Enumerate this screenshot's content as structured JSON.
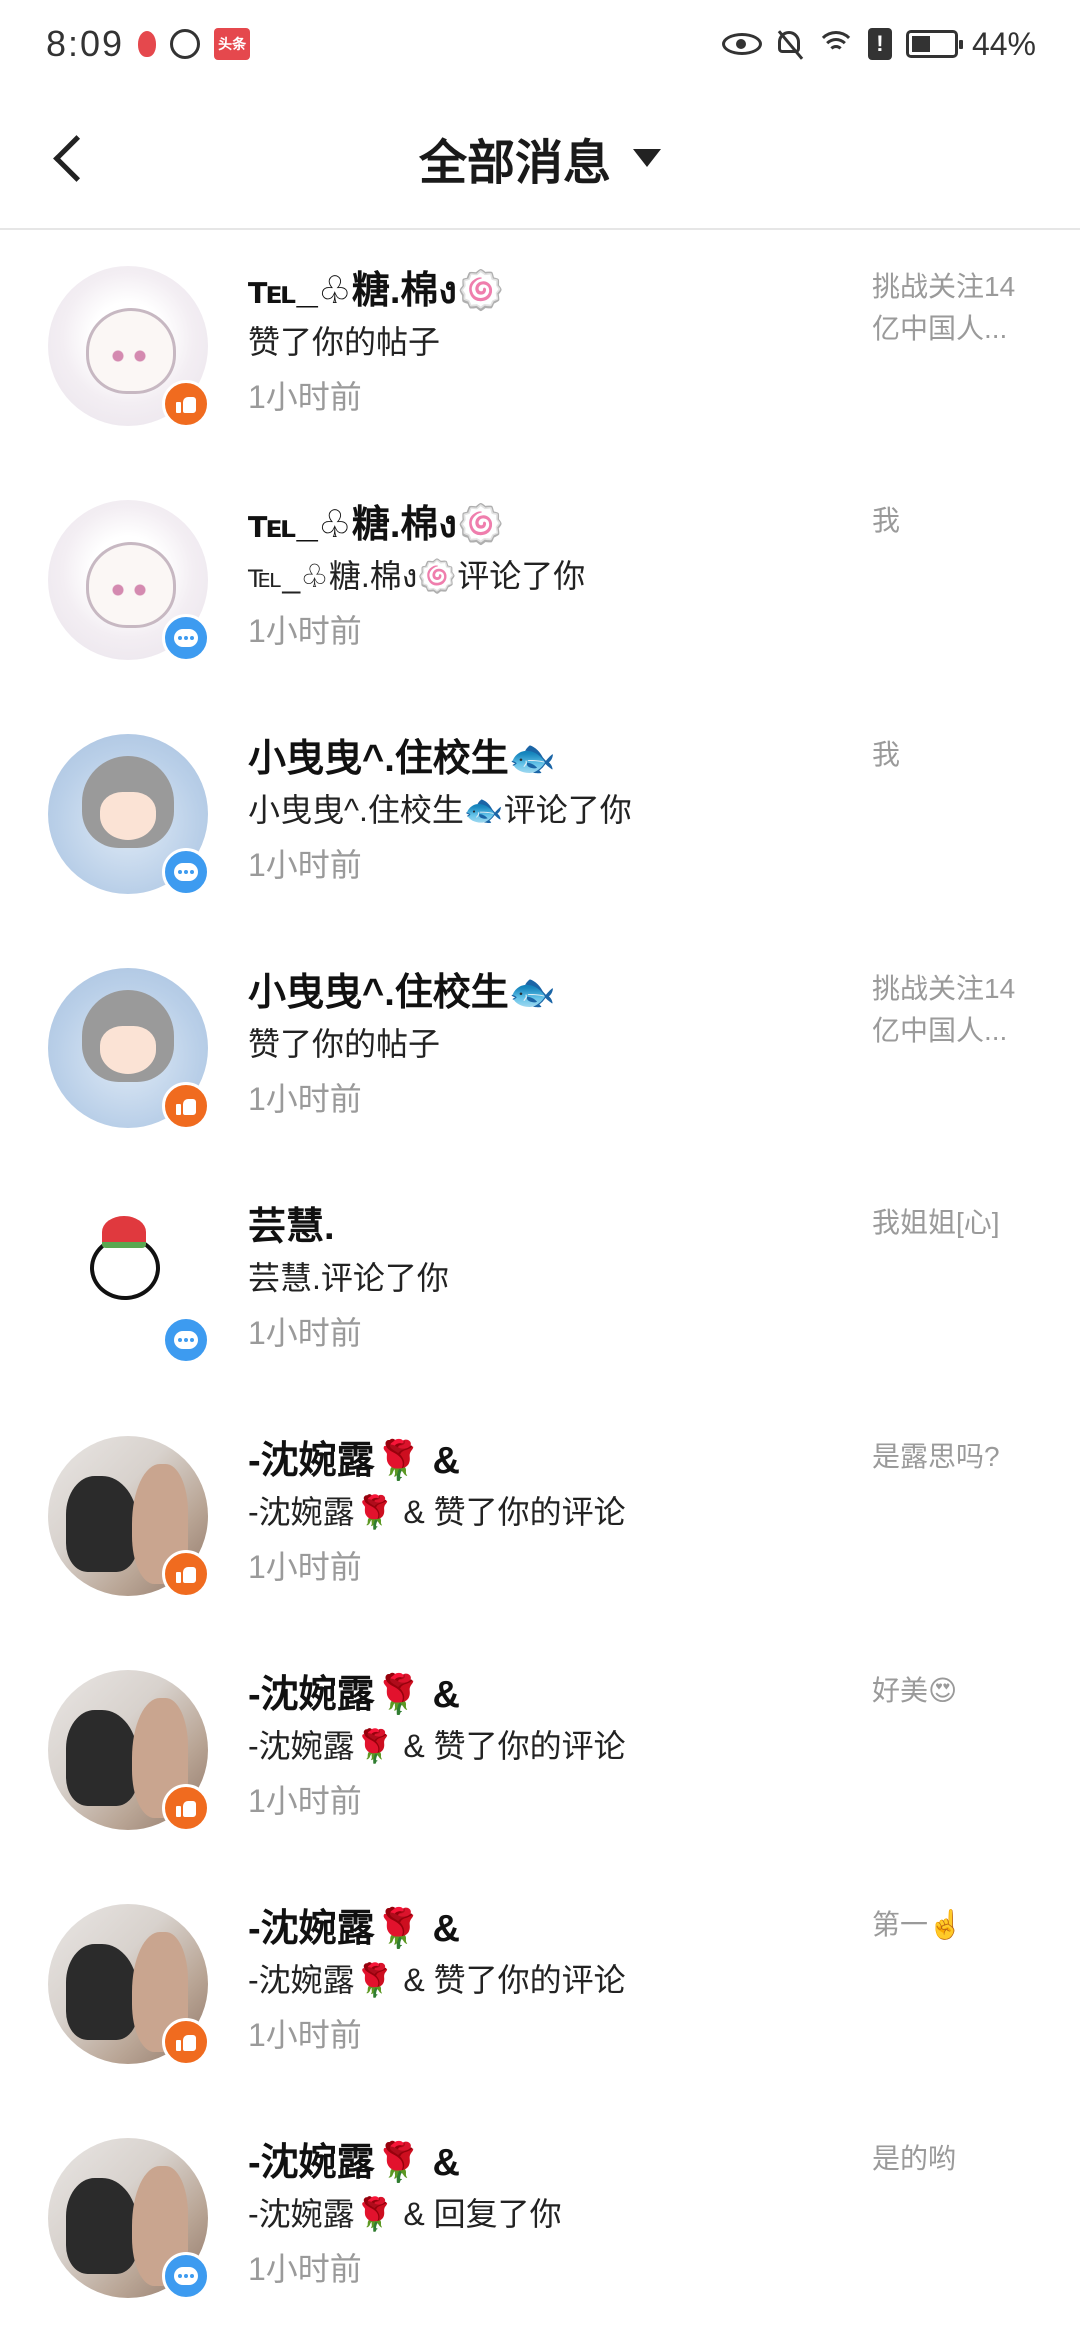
{
  "status_bar": {
    "time": "8:09",
    "battery": "44%",
    "battery_level": 0.44,
    "toutiao_label": "头条"
  },
  "header": {
    "title": "全部消息"
  },
  "messages": [
    {
      "name": "℡_♧糖.棉ง🍥",
      "action": "赞了你的帖子",
      "time": "1小时前",
      "preview": "挑战关注14亿中国人...",
      "type": "like",
      "avatar": "sugar"
    },
    {
      "name": "℡_♧糖.棉ง🍥",
      "action": "℡_♧糖.棉ง🍥评论了你",
      "time": "1小时前",
      "preview": "我",
      "type": "comment",
      "avatar": "sugar"
    },
    {
      "name": "小曳曳^.住校生🐟",
      "action": "小曳曳^.住校生🐟评论了你",
      "time": "1小时前",
      "preview": "我",
      "type": "comment",
      "avatar": "girl"
    },
    {
      "name": "小曳曳^.住校生🐟",
      "action": "赞了你的帖子",
      "time": "1小时前",
      "preview": "挑战关注14亿中国人...",
      "type": "like",
      "avatar": "girl"
    },
    {
      "name": "芸慧.",
      "action": "芸慧.评论了你",
      "time": "1小时前",
      "preview": "我姐姐[心]",
      "type": "comment",
      "avatar": "snowman"
    },
    {
      "name": "-沈婉露🌹 &",
      "action": "-沈婉露🌹 & 赞了你的评论",
      "time": "1小时前",
      "preview": "是露思吗?",
      "type": "like",
      "avatar": "photo"
    },
    {
      "name": "-沈婉露🌹 &",
      "action": "-沈婉露🌹 & 赞了你的评论",
      "time": "1小时前",
      "preview": "好美😍",
      "type": "like",
      "avatar": "photo"
    },
    {
      "name": "-沈婉露🌹 &",
      "action": "-沈婉露🌹 & 赞了你的评论",
      "time": "1小时前",
      "preview": "第一☝️",
      "type": "like",
      "avatar": "photo"
    },
    {
      "name": "-沈婉露🌹 &",
      "action": "-沈婉露🌹 & 回复了你",
      "time": "1小时前",
      "preview": "是的哟",
      "type": "comment",
      "avatar": "photo"
    }
  ]
}
